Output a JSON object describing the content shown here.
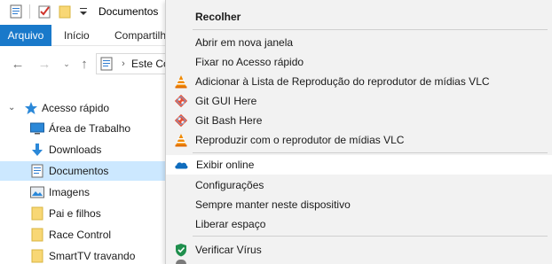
{
  "window": {
    "title": "Documentos"
  },
  "ribbon": {
    "tabs": [
      "Arquivo",
      "Início",
      "Compartilh"
    ]
  },
  "address": {
    "path": "Este Co"
  },
  "nav": {
    "quick_access_label": "Acesso rápido",
    "items": [
      {
        "label": "Área de Trabalho",
        "icon": "desktop-icon"
      },
      {
        "label": "Downloads",
        "icon": "download-icon"
      },
      {
        "label": "Documentos",
        "icon": "documents-icon"
      },
      {
        "label": "Imagens",
        "icon": "pictures-icon"
      },
      {
        "label": "Pai e filhos",
        "icon": "folder-icon"
      },
      {
        "label": "Race Control",
        "icon": "folder-icon"
      },
      {
        "label": "SmartTV travando",
        "icon": "folder-icon"
      }
    ],
    "selected": "Documentos"
  },
  "context_menu": {
    "header": "Recolher",
    "items": [
      {
        "label": "Abrir em nova janela",
        "icon": ""
      },
      {
        "label": "Fixar no Acesso rápido",
        "icon": ""
      },
      {
        "label": "Adicionar à Lista de Reprodução do reprodutor de mídias VLC",
        "icon": "vlc-icon"
      },
      {
        "label": "Git GUI Here",
        "icon": "git-icon"
      },
      {
        "label": "Git Bash Here",
        "icon": "git-icon"
      },
      {
        "label": "Reproduzir com o reprodutor de mídias VLC",
        "icon": "vlc-icon"
      },
      {
        "label": "Exibir online",
        "icon": "onedrive-icon"
      },
      {
        "label": "Configurações",
        "icon": ""
      },
      {
        "label": "Sempre manter neste dispositivo",
        "icon": ""
      },
      {
        "label": "Liberar espaço",
        "icon": ""
      },
      {
        "label": "Verificar Vírus",
        "icon": "shield-icon"
      }
    ],
    "hovered": "Exibir online"
  },
  "colors": {
    "ribbon_file_tab": "#1979ca",
    "selection": "#cce8ff",
    "menu_background": "#f2f2f2",
    "folder": "#f8d775"
  }
}
